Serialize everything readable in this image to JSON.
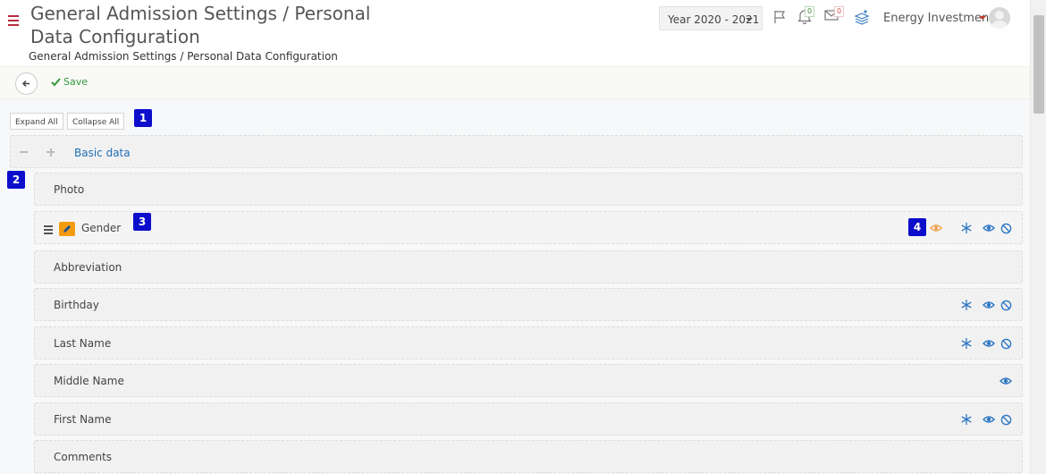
{
  "header": {
    "title": "General Admission Settings / Personal Data Configuration",
    "breadcrumb": "General Admission Settings / Personal Data Configuration",
    "year_select": "Year 2020 - 2021",
    "notifications_count": "0",
    "messages_count": "0",
    "user_name": "Energy Investment"
  },
  "toolbar": {
    "save_label": "Save"
  },
  "controls": {
    "expand_all": "Expand All",
    "collapse_all": "Collapse All"
  },
  "badges": [
    "1",
    "2",
    "3",
    "4"
  ],
  "group": {
    "label": "Basic data"
  },
  "fields": [
    {
      "label": "Photo",
      "icons": []
    },
    {
      "label": "Gender",
      "icons": [
        "eye-orange",
        "asterisk",
        "eye",
        "ban"
      ],
      "editable": true
    },
    {
      "label": "Abbreviation",
      "icons": []
    },
    {
      "label": "Birthday",
      "icons": [
        "asterisk",
        "eye",
        "ban"
      ]
    },
    {
      "label": "Last Name",
      "icons": [
        "asterisk",
        "eye",
        "ban"
      ]
    },
    {
      "label": "Middle Name",
      "icons": [
        "eye"
      ]
    },
    {
      "label": "First Name",
      "icons": [
        "asterisk",
        "eye",
        "ban"
      ]
    },
    {
      "label": "Comments",
      "icons": []
    }
  ],
  "colors": {
    "accent_blue": "#1f6fb5",
    "save_green": "#2e9a3c",
    "badge_blue": "#0d0dcc",
    "edit_orange": "#f39c12",
    "menu_red": "#b52c3c"
  }
}
